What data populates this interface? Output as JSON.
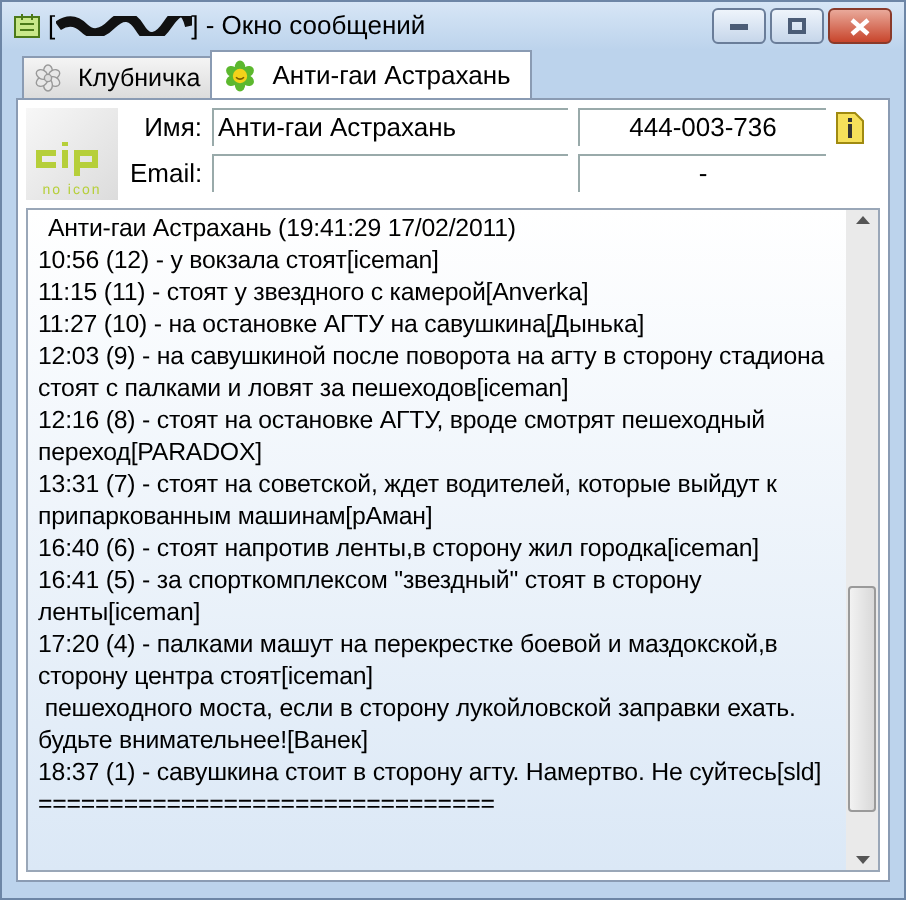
{
  "window": {
    "title_open": "[",
    "title": "] - Окно сообщений"
  },
  "tabs": [
    {
      "label": "Клубничка",
      "selected": false,
      "kind": "flower"
    },
    {
      "label": "Анти-гаи Астрахань",
      "selected": true,
      "kind": "smiley"
    }
  ],
  "contact": {
    "logo_text": "no icon",
    "name_label": "Имя:",
    "name": "Анти-гаи Астрахань",
    "number": "444-003-736",
    "email_label": "Email:",
    "email_extra": "-"
  },
  "chat": {
    "header": "Анти-гаи Астрахань (19:41:29 17/02/2011)",
    "messages": [
      "10:56 (12) - у вокзала стоят[iceman]",
      "11:15 (11) - стоят у звездного с камерой[Anverka]",
      "11:27 (10) - на остановке АГТУ на савушкина[Дынька]",
      "12:03 (9) - на савушкиной после поворота на агту в сторону стадиона стоят с палками и ловят за пешеходов[iceman]",
      "12:16 (8) - стоят на остановке АГТУ, вроде смотрят пешеходный переход[PARADOX]",
      "13:31 (7) - стоят на советской, ждет водителей, которые выйдут к припаркованным машинам[рАман]",
      "16:40 (6) - стоят напротив ленты,в сторону жил городка[iceman]",
      "16:41 (5) - за спорткомплексом \"звездный\" стоят в сторону ленты[iceman]",
      "17:20 (4) - палками машут на перекрестке боевой и маздокской,в сторону центра стоят[iceman]",
      " пешеходного моста, если в сторону лукойловской заправки ехать. будьте внимательнее![Ванек]",
      "18:37 (1) - савушкина стоит в сторону агту. Намертво. Не суйтесь[sld]",
      "================================"
    ]
  }
}
